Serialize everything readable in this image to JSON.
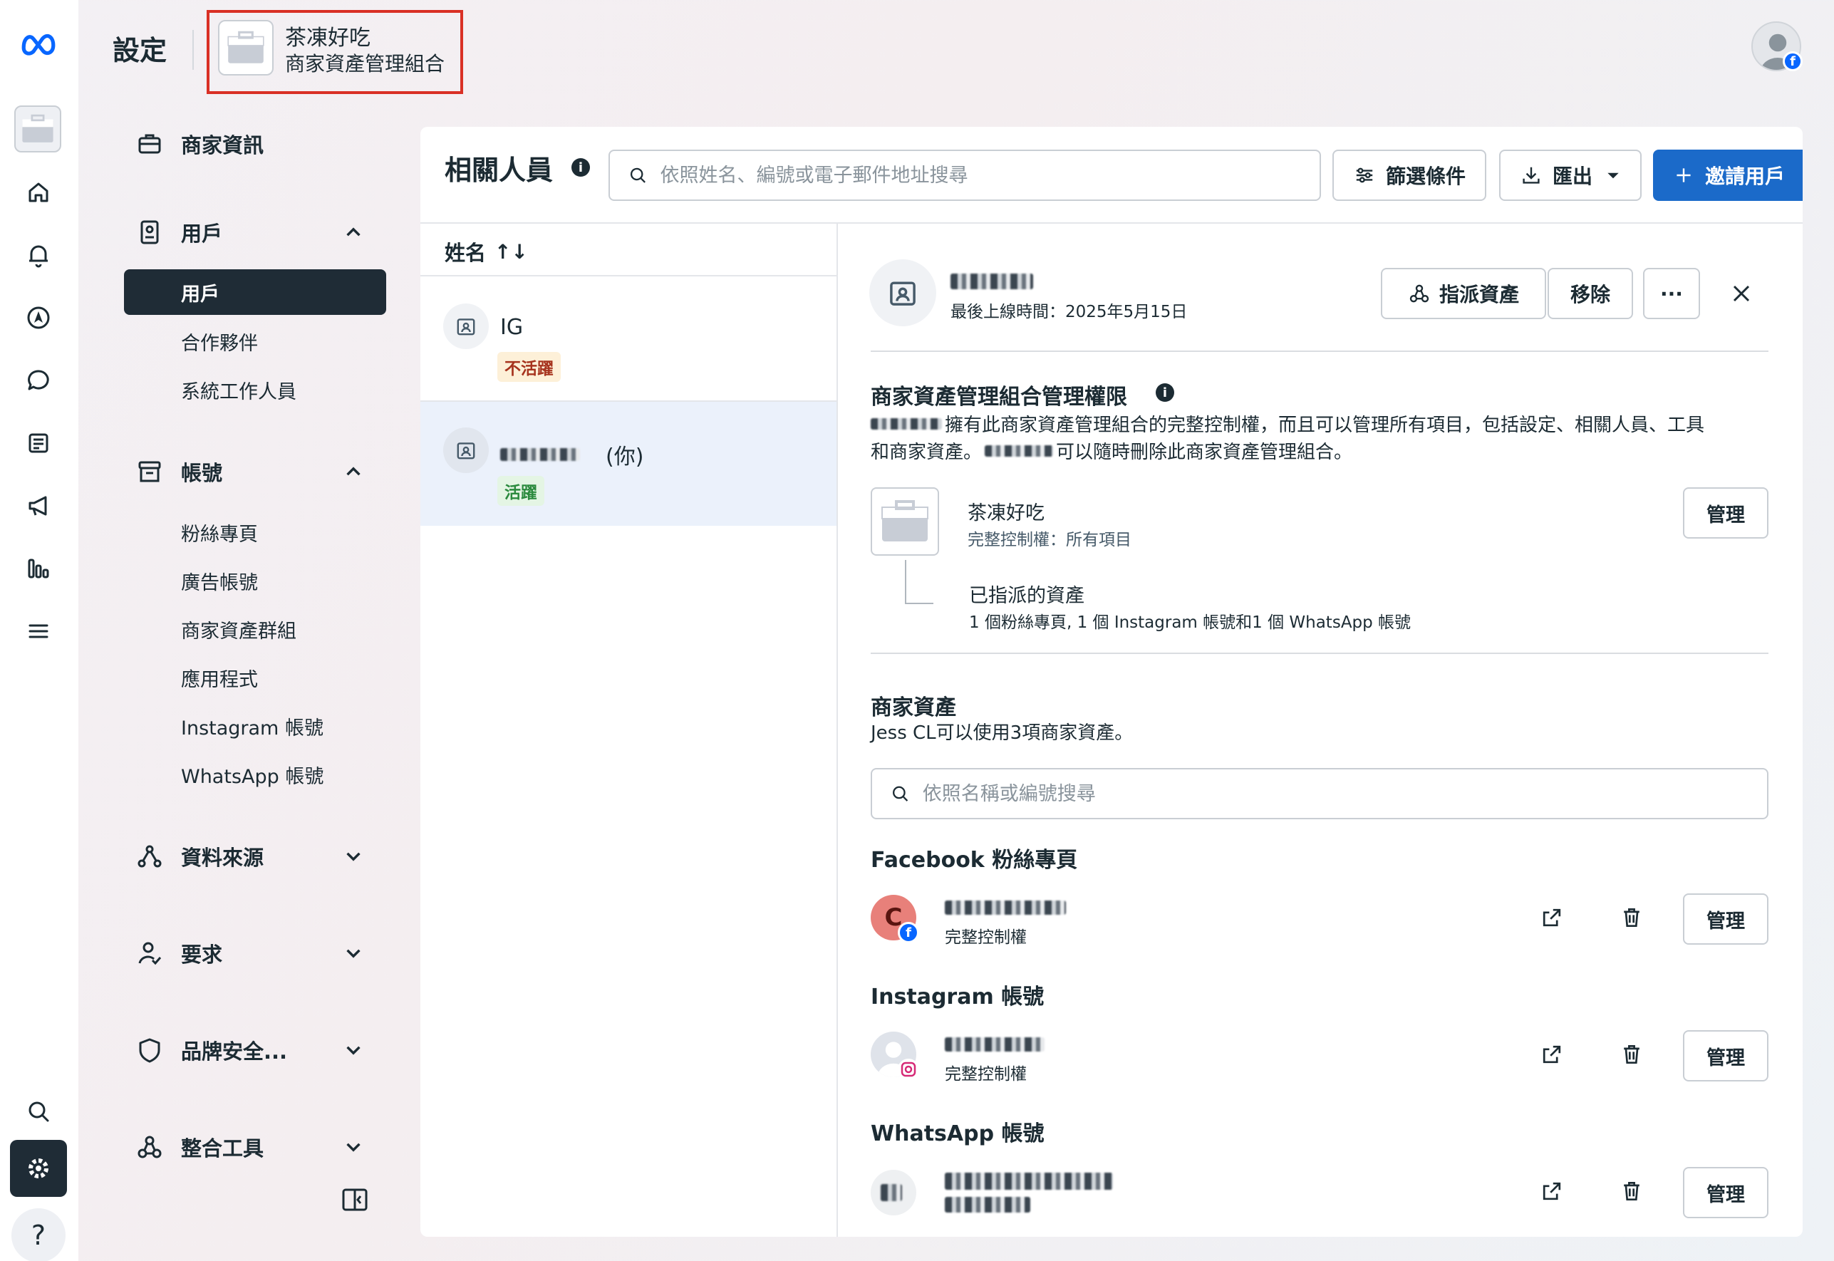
{
  "header": {
    "title": "設定",
    "business_name": "茶凍好吃",
    "business_type": "商家資產管理組合"
  },
  "icons": {
    "rail": [
      "meta-logo-icon",
      "business-portfolio-icon",
      "home-icon",
      "bell-icon",
      "compass-icon",
      "chat-bubble-icon",
      "content-icon",
      "megaphone-icon",
      "insights-icon",
      "menu-icon",
      "search-icon",
      "settings-icon",
      "help-icon"
    ]
  },
  "colors": {
    "primary": "#1b6ac9",
    "active_nav": "#1f2c36",
    "inactive_badge_bg": "#fdf0d8",
    "inactive_badge_fg": "#a6331e",
    "active_badge_bg": "#e4f5e4",
    "active_badge_fg": "#2b8a3e",
    "highlight": "#d93025"
  },
  "sidebar": {
    "business_info": "商家資訊",
    "users_section": "用戶",
    "users_items": [
      "用戶",
      "合作夥伴",
      "系統工作人員"
    ],
    "accounts_section": "帳號",
    "accounts_items": [
      "粉絲專頁",
      "廣告帳號",
      "商家資產群組",
      "應用程式",
      "Instagram 帳號",
      "WhatsApp 帳號"
    ],
    "data_sources": "資料來源",
    "requests": "要求",
    "brand_safety": "品牌安全...",
    "integrations": "整合工具",
    "help": "?"
  },
  "people": {
    "title": "相關人員",
    "search_placeholder": "依照姓名、編號或電子郵件地址搜尋",
    "filter_label": "篩選條件",
    "export_label": "匯出",
    "invite_label": "邀請用戶",
    "name_column": "姓名",
    "sort_glyph": "↑↓",
    "rows": [
      {
        "name": "IG",
        "status": "不活躍"
      },
      {
        "name_suffix": "(你)",
        "status": "活躍"
      }
    ]
  },
  "detail": {
    "last_seen": "最後上線時間：2025年5月15日",
    "assign_label": "指派資產",
    "remove_label": "移除",
    "more_label": "···",
    "permissions_title": "商家資產管理組合管理權限",
    "permissions_desc_1": "擁有此商家資產管理組合的完整控制權，而且可以管理所有項目，包括設定、相關人員、工具",
    "permissions_desc_2a": "和商家資產。",
    "permissions_desc_2b": "可以隨時刪除此商家資產管理組合。",
    "portfolio_name": "茶凍好吃",
    "portfolio_access": "完整控制權：所有項目",
    "manage_label": "管理",
    "assigned_title": "已指派的資產",
    "assigned_desc": "1 個粉絲專頁, 1 個 Instagram 帳號和1 個 WhatsApp 帳號",
    "assets_title": "商家資產",
    "assets_desc": "Jess CL可以使用3項商家資產。",
    "assets_search_placeholder": "依照名稱或編號搜尋",
    "facebook_title": "Facebook 粉絲專頁",
    "facebook_avatar_letter": "C",
    "instagram_title": "Instagram 帳號",
    "whatsapp_title": "WhatsApp 帳號",
    "full_control": "完整控制權"
  }
}
